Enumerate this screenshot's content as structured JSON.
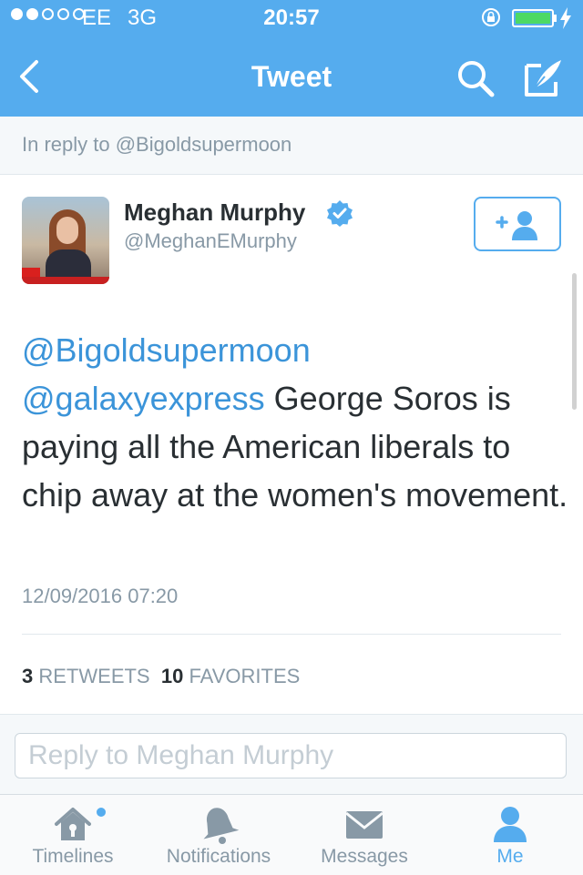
{
  "status_bar": {
    "carrier": "EE",
    "network": "3G",
    "time": "20:57",
    "signal_strength": 2,
    "signal_max": 5,
    "battery_fraction": 1.0,
    "battery_color": "#4cd964",
    "icons": [
      "signal-dots",
      "rotation-lock-icon",
      "battery-icon",
      "charging-bolt-icon"
    ]
  },
  "nav": {
    "title": "Tweet",
    "back_icon": "chevron-left-icon",
    "search_icon": "search-icon",
    "compose_icon": "compose-icon",
    "background": "#55acee"
  },
  "reply_context": "In reply to @Bigoldsupermoon",
  "tweet": {
    "author_name": "Meghan Murphy",
    "author_handle": "@MeghanEMurphy",
    "verified": true,
    "follow_icon": "add-user-icon",
    "mention_1": "@Bigoldsupermoon",
    "mention_2": "@galaxyexpress",
    "body": " George Soros is paying all the American liberals to chip away at the women's movement.",
    "timestamp": "12/09/2016 07:20",
    "retweets_count": "3",
    "retweets_label": "RETWEETS",
    "favorites_count": "10",
    "favorites_label": "FAVORITES"
  },
  "reply": {
    "placeholder": "Reply to Meghan Murphy",
    "value": ""
  },
  "tabs": [
    {
      "label": "Timelines",
      "icon": "home-icon",
      "active": false,
      "has_new": true
    },
    {
      "label": "Notifications",
      "icon": "bell-icon",
      "active": false
    },
    {
      "label": "Messages",
      "icon": "envelope-icon",
      "active": false
    },
    {
      "label": "Me",
      "icon": "person-icon",
      "active": true
    }
  ],
  "colors": {
    "accent": "#55acee",
    "link": "#3b94d9",
    "muted": "#8899a6",
    "text": "#292f33"
  }
}
